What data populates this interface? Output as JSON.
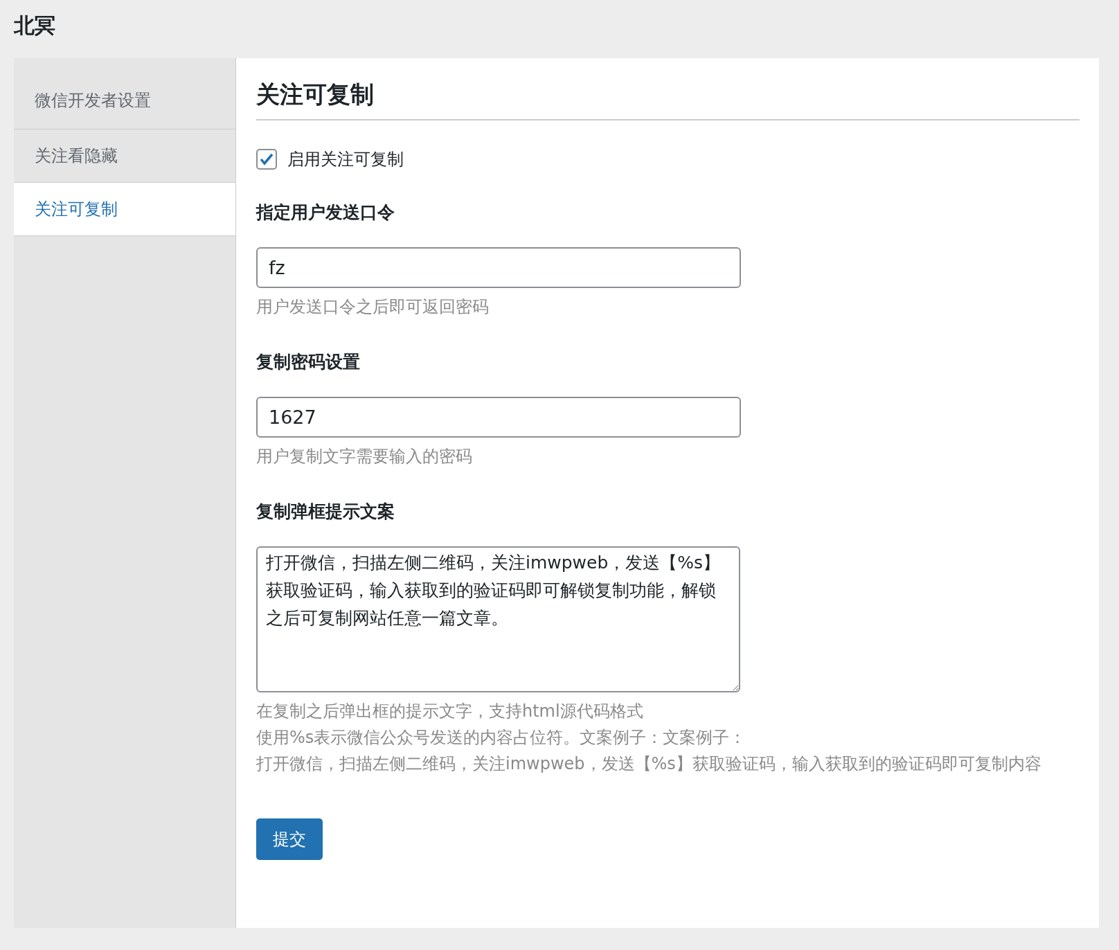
{
  "site_title": "北冥",
  "sidebar": {
    "items": [
      {
        "label": "微信开发者设置",
        "selected": false
      },
      {
        "label": "关注看隐藏",
        "selected": false
      },
      {
        "label": "关注可复制",
        "selected": true
      }
    ]
  },
  "panel": {
    "heading": "关注可复制",
    "enable": {
      "label": "启用关注可复制",
      "checked": true
    },
    "fields": [
      {
        "kind": "input",
        "label": "指定用户发送口令",
        "value": "fz",
        "help": [
          "用户发送口令之后即可返回密码"
        ]
      },
      {
        "kind": "input",
        "label": "复制密码设置",
        "value": "1627",
        "help": [
          "用户复制文字需要输入的密码"
        ]
      },
      {
        "kind": "textarea",
        "label": "复制弹框提示文案",
        "value": "打开微信，扫描左侧二维码，关注imwpweb，发送【%s】获取验证码，输入获取到的验证码即可解锁复制功能，解锁之后可复制网站任意一篇文章。",
        "help": [
          "在复制之后弹出框的提示文字，支持html源代码格式",
          "使用%s表示微信公众号发送的内容占位符。文案例子：文案例子：",
          "打开微信，扫描左侧二维码，关注imwpweb，发送【%s】获取验证码，输入获取到的验证码即可复制内容"
        ]
      }
    ],
    "submit": "提交"
  }
}
